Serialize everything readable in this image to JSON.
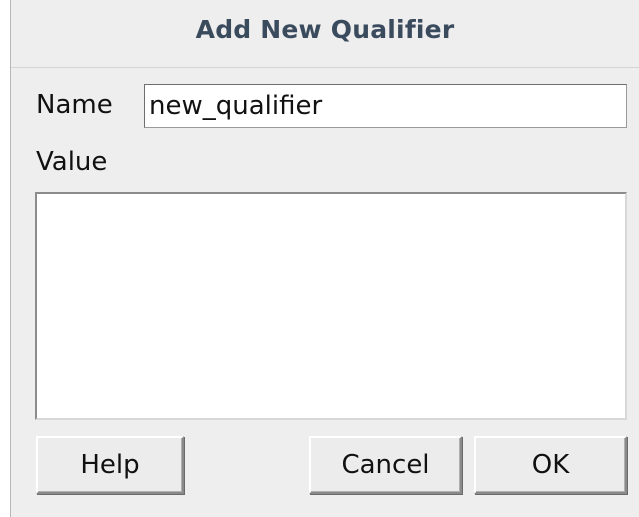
{
  "dialog": {
    "title": "Add New Qualifier",
    "name_label": "Name",
    "name_value": "new_qualifier",
    "value_label": "Value",
    "value_text": "",
    "buttons": {
      "help": "Help",
      "cancel": "Cancel",
      "ok": "OK"
    }
  }
}
